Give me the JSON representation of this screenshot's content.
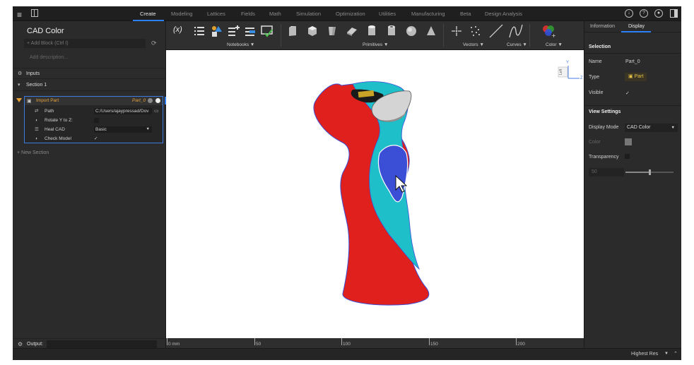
{
  "nav": {
    "tabs": [
      "Create",
      "Modeling",
      "Lattices",
      "Fields",
      "Math",
      "Simulation",
      "Optimization",
      "Utilities",
      "Manufacturing",
      "Beta",
      "Design Analysis"
    ],
    "active_tab": "Create",
    "right_icons": [
      "download-icon",
      "help-icon",
      "account-icon",
      "panel-icon"
    ],
    "help_glyph": "?"
  },
  "left": {
    "title": "CAD Color",
    "add_block_placeholder": "+ Add Block  (Ctrl I)",
    "description_placeholder": "Add description...",
    "inputs_label": "Inputs",
    "section_label": "Section 1",
    "block": {
      "title": "Import Part",
      "part_name": "Part_0",
      "rows": [
        {
          "label": "Path",
          "value": "C:/Users/ajaypressad/Dov",
          "kind": "field"
        },
        {
          "label": "Rotate Y to Z:",
          "value": "",
          "kind": "checkbox"
        },
        {
          "label": "Heal CAD",
          "value": "Basic",
          "kind": "select"
        },
        {
          "label": "Check Model",
          "value": "✓",
          "kind": "text"
        }
      ]
    },
    "new_section_label": "+ New Section",
    "output_label": "Output:"
  },
  "toolbar": {
    "groups": [
      "Notebooks ▼",
      "Primitives ▼",
      "Vectors ▼",
      "Curves ▼",
      "Color ▼"
    ],
    "variable_glyph": "(x)"
  },
  "viewport": {
    "axis_y": "Y",
    "axis_z": "Z",
    "viewcube_label": "Left",
    "ruler_labels": [
      "0 mm",
      "50",
      "100",
      "150",
      "200"
    ]
  },
  "right": {
    "tabs": [
      "Information",
      "Display"
    ],
    "active_tab": "Display",
    "selection_header": "Selection",
    "name_key": "Name",
    "name_value": "Part_0",
    "type_key": "Type",
    "type_value": "Part",
    "visible_key": "Visible",
    "visible_value": "✓",
    "view_settings_header": "View Settings",
    "display_mode_key": "Display Mode",
    "display_mode_value": "CAD Color",
    "color_key": "Color",
    "transparency_key": "Transparency",
    "transparency_value": "50",
    "transparency_fraction": 0.5
  },
  "status": {
    "resolution": "Highest Res"
  },
  "colors": {
    "accent": "#2d7ff9",
    "block_title": "#e8a23a",
    "model_red": "#e0201c",
    "model_cyan": "#1fbfc9",
    "model_blue": "#3b4fd6"
  }
}
